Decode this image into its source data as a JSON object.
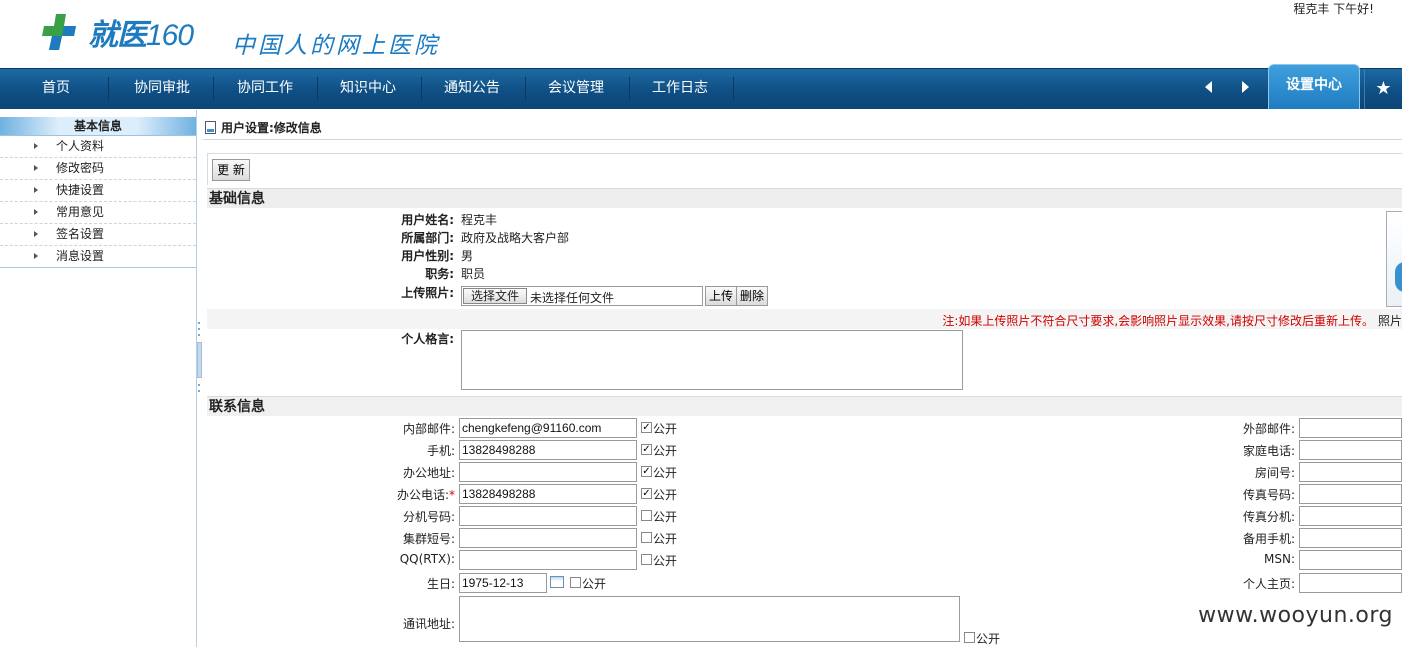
{
  "header": {
    "logo_text": "就医",
    "logo_num": "160",
    "slogan": "中国人的网上医院",
    "greeting": "程克丰 下午好!"
  },
  "nav": {
    "items": [
      "首页",
      "协同审批",
      "协同工作",
      "知识中心",
      "通知公告",
      "会议管理",
      "工作日志"
    ],
    "active": "设置中心",
    "star": "★"
  },
  "sidebar": {
    "title": "基本信息",
    "items": [
      "个人资料",
      "修改密码",
      "快捷设置",
      "常用意见",
      "签名设置",
      "消息设置"
    ]
  },
  "main": {
    "title": "用户设置:修改信息",
    "update_button": "更 新",
    "basic": {
      "heading": "基础信息",
      "name_label": "用户姓名:",
      "name": "程克丰",
      "dept_label": "所属部门:",
      "dept": "政府及战略大客户部",
      "gender_label": "用户性别:",
      "gender": "男",
      "title_label": "职务:",
      "title": "职员",
      "photo_label": "上传照片:",
      "choose_file": "选择文件",
      "no_file": "未选择任何文件",
      "upload": "上传",
      "delete": "删除",
      "note": "注:如果上传照片不符合尺寸要求,会影响照片显示效果,请按尺寸修改后重新上传。",
      "note_tail": "照片",
      "motto_label": "个人格言:"
    },
    "contact": {
      "heading": "联系信息",
      "public": "公开",
      "left": [
        {
          "label": "内部邮件:",
          "value": "chengkefeng@91160.com",
          "checked": true
        },
        {
          "label": "手机:",
          "value": "13828498288",
          "checked": true
        },
        {
          "label": "办公地址:",
          "value": "",
          "checked": true
        },
        {
          "label": "办公电话:",
          "value": "13828498288",
          "checked": true,
          "required": "*"
        },
        {
          "label": "分机号码:",
          "value": "",
          "checked": false
        },
        {
          "label": "集群短号:",
          "value": "",
          "checked": false
        },
        {
          "label": "QQ(RTX):",
          "value": "",
          "checked": false
        },
        {
          "label": "生日:",
          "value": "1975-12-13",
          "checked": false
        }
      ],
      "address_label": "通讯地址:",
      "right": [
        "外部邮件:",
        "家庭电话:",
        "房间号:",
        "传真号码:",
        "传真分机:",
        "备用手机:",
        "MSN:",
        "个人主页:"
      ]
    }
  },
  "watermark": "www.wooyun.org"
}
